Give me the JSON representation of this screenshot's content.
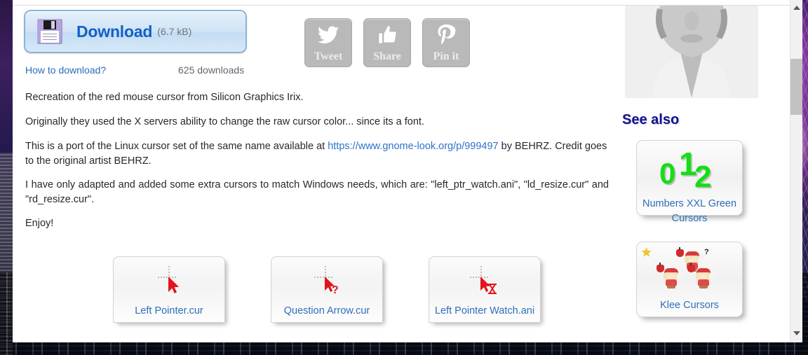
{
  "download": {
    "icon": "floppy-disk-icon",
    "label": "Download",
    "size": "(6.7 kB)",
    "how_to_link": "How to download?",
    "downloads_count": "625 downloads"
  },
  "social_buttons": [
    {
      "icon": "twitter-bird-icon",
      "label": "Tweet"
    },
    {
      "icon": "thumbs-up-icon",
      "label": "Share"
    },
    {
      "icon": "pinterest-p-icon",
      "label": "Pin it"
    }
  ],
  "description": {
    "p1": "Recreation of the red mouse cursor from Silicon Graphics Irix.",
    "p2": "Originally they used the X servers ability to change the raw cursor color... since its a font.",
    "p3_before": "This is a port of the Linux cursor set of the same name available at ",
    "p3_link": "https://www.gnome-look.org/p/999497",
    "p3_after": " by BEHRZ. Credit goes to the original artist BEHRZ.",
    "p4": "I have only adapted and added some extra cursors to match Windows needs, which are: \"left_ptr_watch.ani\", \"ld_resize.cur\" and \"rd_resize.cur\".",
    "p5": "Enjoy!"
  },
  "cursor_cards": [
    {
      "icon": "red-arrow-cursor-icon",
      "label": "Left Pointer.cur"
    },
    {
      "icon": "red-arrow-question-cursor-icon",
      "label": "Question Arrow.cur"
    },
    {
      "icon": "red-arrow-hourglass-cursor-icon",
      "label": "Left Pointer Watch.ani"
    }
  ],
  "sidebar": {
    "avatar": "user-avatar-placeholder",
    "see_also_title": "See also",
    "cards": [
      {
        "art": "green-numbers-icon",
        "digits": [
          "0",
          "1",
          "2"
        ],
        "label": "Numbers XXL Green Cursors",
        "starred": false
      },
      {
        "art": "klee-sprites-icon",
        "label": "Klee Cursors",
        "starred": true,
        "star_glyph": "★"
      }
    ]
  },
  "scrollbar": {
    "up_arrow": "scroll-up-arrow-icon",
    "down_arrow": "scroll-down-arrow-icon",
    "thumb": "scroll-thumb"
  },
  "colors": {
    "link": "#2f6fba",
    "download_text": "#1160c8",
    "see_also": "#13138c",
    "green": "#12e012",
    "cursor_red": "#e0161b"
  }
}
